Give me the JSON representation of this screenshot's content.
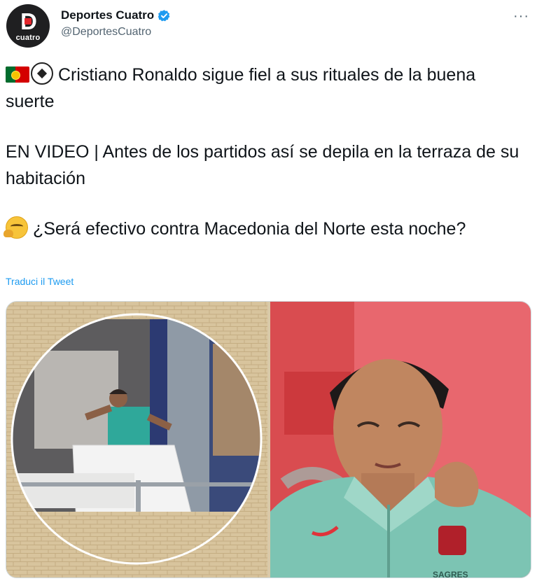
{
  "author": {
    "display_name": "Deportes Cuatro",
    "handle": "@DeportesCuatro",
    "avatar_letter": "D",
    "avatar_caption": "cuatro",
    "verified_color": "#1d9bf0"
  },
  "menu_label": "···",
  "tweet": {
    "line1": "Cristiano Ronaldo sigue fiel a sus rituales de la buena suerte",
    "line2": "EN VIDEO | Antes de los partidos así se depila en la terraza de su habitación",
    "line3": "¿Será efectivo contra Macedonia del Norte esta noche?",
    "emojis": [
      "portugal-flag-icon",
      "soccer-ball-icon",
      "thinking-face-icon"
    ]
  },
  "translate_label": "Traduci il Tweet",
  "media": {
    "images": [
      "balcony-photo",
      "player-portrait-photo"
    ],
    "shirt_text": "SAGRES"
  },
  "colors": {
    "link": "#1d9bf0",
    "secondary_text": "#536471",
    "primary_text": "#0f1419"
  }
}
